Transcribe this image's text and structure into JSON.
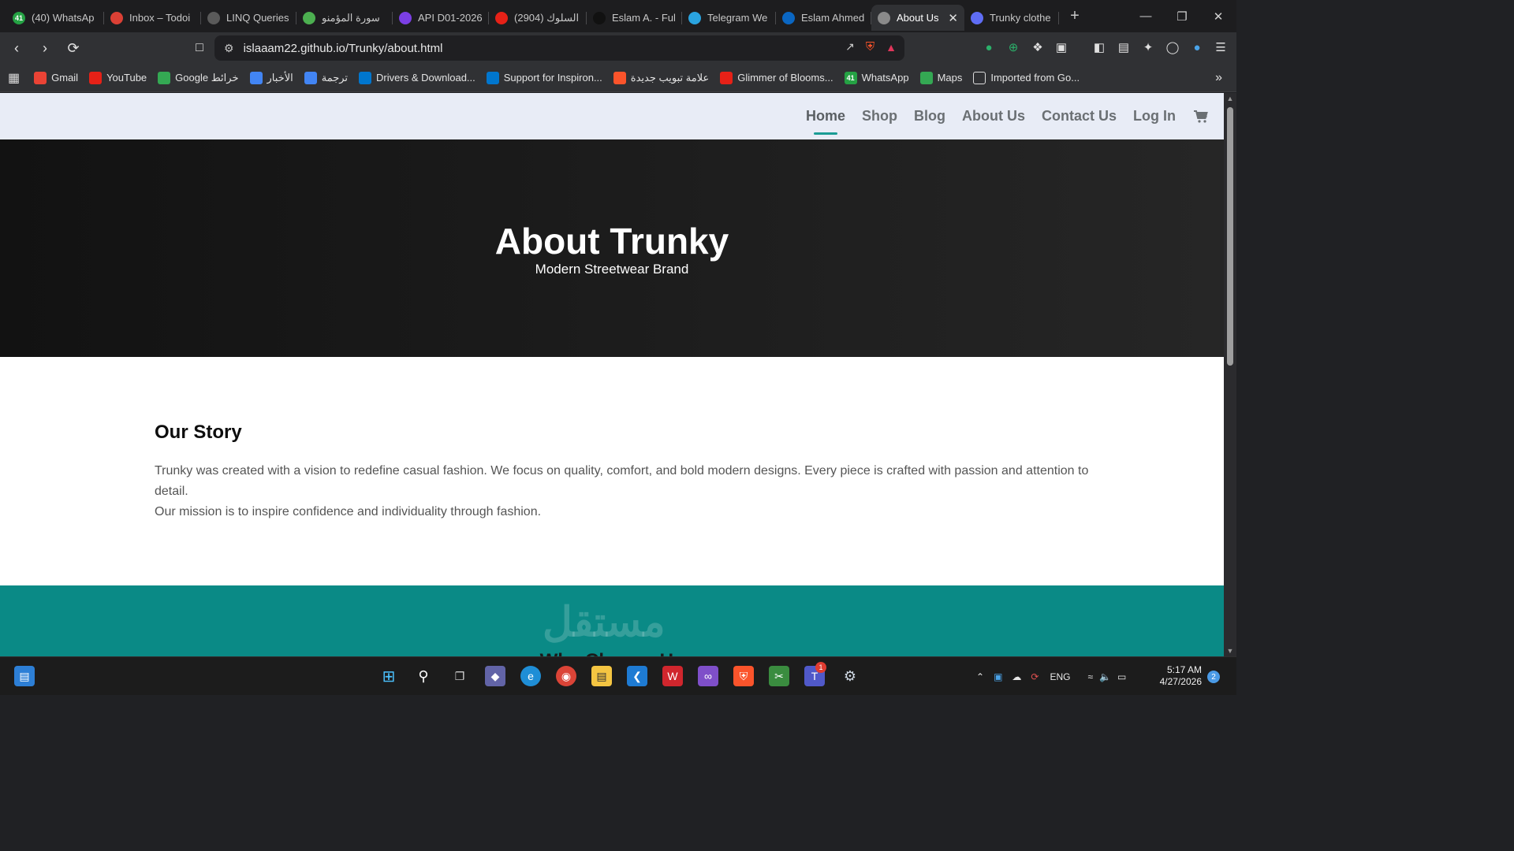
{
  "browser": {
    "tabs": [
      {
        "title": "(40) WhatsAp",
        "icon": "whatsapp-icon",
        "color": "#25a244",
        "badge": "41"
      },
      {
        "title": "Inbox – Todoi",
        "icon": "todoist-icon",
        "color": "#db4035"
      },
      {
        "title": "LINQ Queries",
        "icon": "chatgpt-icon",
        "color": "#5a5a5a"
      },
      {
        "title": "سورة المؤمنو",
        "icon": "quran-icon",
        "color": "#4caf50"
      },
      {
        "title": "API D01-2026",
        "icon": "video-icon",
        "color": "#7b3fe4"
      },
      {
        "title": "السلوك (2904)",
        "icon": "youtube-icon",
        "color": "#e62117"
      },
      {
        "title": "Eslam A. - Ful",
        "icon": "upwork-icon",
        "color": "#111111"
      },
      {
        "title": "Telegram We",
        "icon": "telegram-icon",
        "color": "#2aa3df"
      },
      {
        "title": "Eslam Ahmed",
        "icon": "linkedin-icon",
        "color": "#0a66c2"
      },
      {
        "title": "About Us",
        "icon": "globe-icon",
        "color": "#8a8a8a",
        "active": true
      },
      {
        "title": "Trunky clothe",
        "icon": "copilot-icon",
        "color": "#5f6df5"
      }
    ],
    "new_tab": "+",
    "url": "islaaam22.github.io/Trunky/about.html"
  },
  "bookmarks": [
    {
      "label": "Gmail",
      "icon": "gmail-icon",
      "color": "#ea4335"
    },
    {
      "label": "YouTube",
      "icon": "youtube-icon",
      "color": "#e62117"
    },
    {
      "label": "Google خرائط",
      "icon": "maps-icon",
      "color": "#34a853"
    },
    {
      "label": "الأخبار",
      "icon": "news-icon",
      "color": "#4285f4"
    },
    {
      "label": "ترجمة",
      "icon": "translate-icon",
      "color": "#4285f4"
    },
    {
      "label": "Drivers & Download...",
      "icon": "dell-icon",
      "color": "#0076ce"
    },
    {
      "label": "Support for Inspiron...",
      "icon": "dell-icon",
      "color": "#0076ce"
    },
    {
      "label": "علامة تبويب جديدة",
      "icon": "brave-icon",
      "color": "#fb542b"
    },
    {
      "label": "Glimmer of Blooms...",
      "icon": "youtube-icon",
      "color": "#e62117"
    },
    {
      "label": "WhatsApp",
      "icon": "whatsapp-icon",
      "color": "#25a244",
      "badge": "41"
    },
    {
      "label": "Maps",
      "icon": "maps-icon",
      "color": "#34a853"
    },
    {
      "label": "Imported from Go...",
      "icon": "folder-icon",
      "color": "#303134"
    }
  ],
  "site": {
    "nav": [
      "Home",
      "Shop",
      "Blog",
      "About Us",
      "Contact Us",
      "Log In"
    ],
    "active_nav": "Home",
    "accent": "#1a9c94",
    "hero": {
      "title": "About Trunky",
      "subtitle": "Modern Streetwear Brand"
    },
    "story": {
      "heading": "Our Story",
      "paragraph1": "Trunky was created with a vision to redefine casual fashion. We focus on quality, comfort, and bold modern designs. Every piece is crafted with passion and attention to detail.",
      "paragraph2": "Our mission is to inspire confidence and individuality through fashion."
    },
    "next_section": {
      "color": "#0a8a86",
      "partial_heading": "Why Choose Us"
    }
  },
  "watermark": "مستقل",
  "taskbar": {
    "lang": "ENG",
    "time": "5:17 AM",
    "date": "4/27/2026",
    "notifications": "2",
    "teams_badge": "1"
  }
}
